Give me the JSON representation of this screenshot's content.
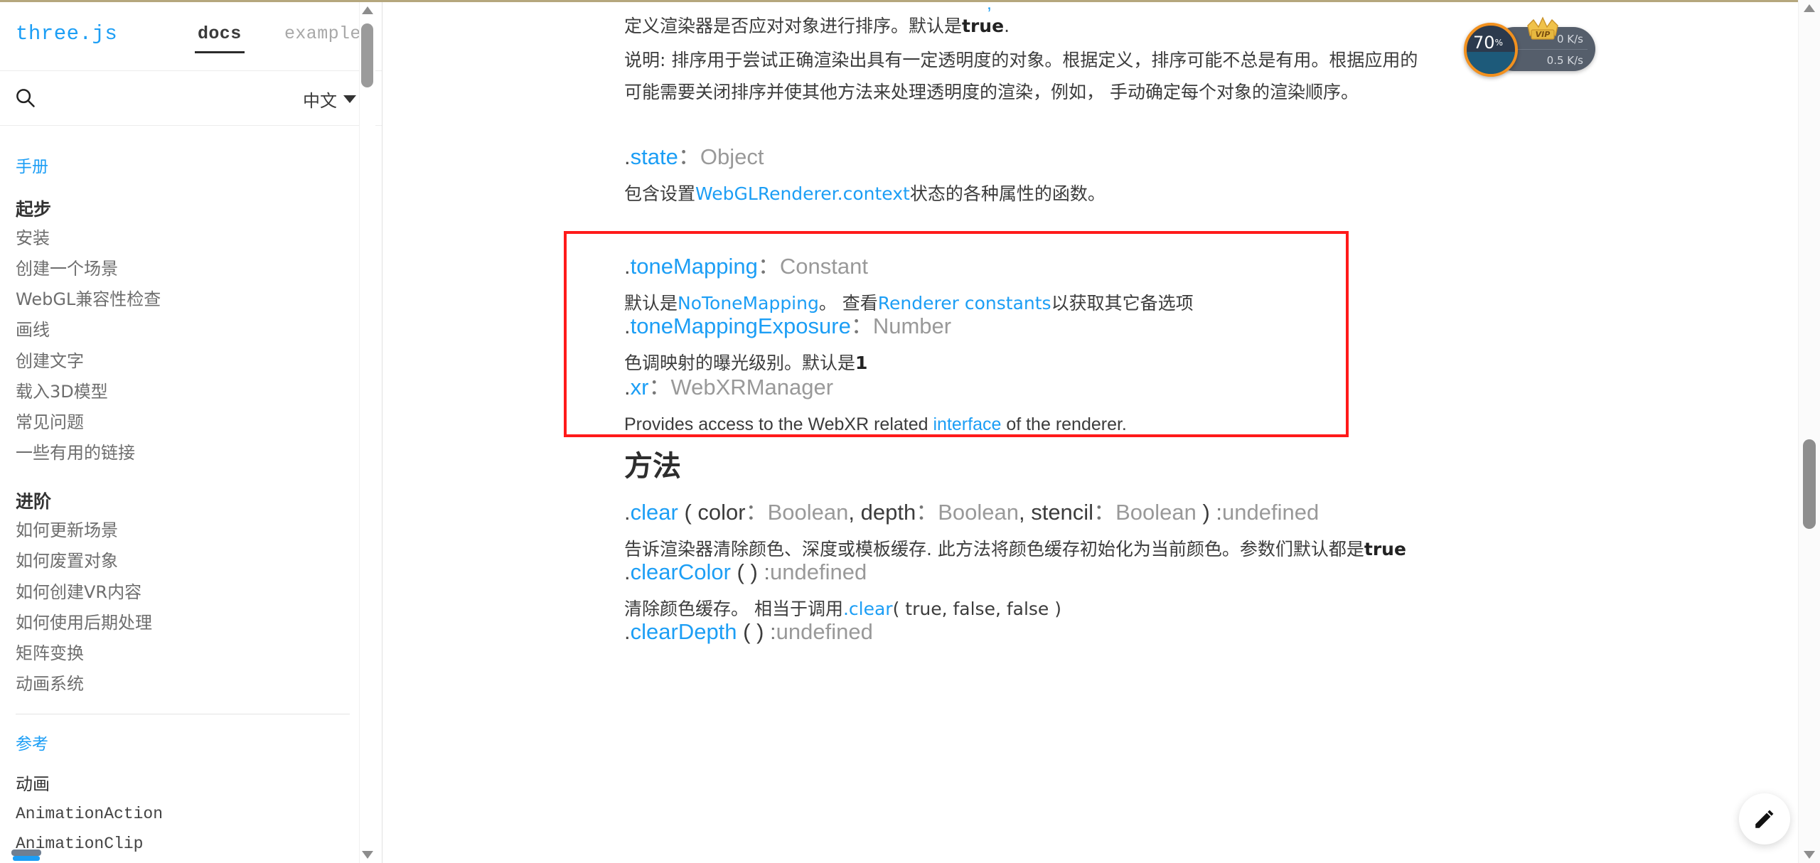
{
  "header": {
    "brand": "three.js",
    "tabs": [
      {
        "label": "docs",
        "active": true
      },
      {
        "label": "examples",
        "active": false
      }
    ],
    "search_icon": "search-icon",
    "language": {
      "label": "中文",
      "caret": "chevron-down-icon"
    }
  },
  "sidebar": {
    "sections": [
      {
        "heading": "手册",
        "groups": [
          {
            "title": "起步",
            "items": [
              "安装",
              "创建一个场景",
              "WebGL兼容性检查",
              "画线",
              "创建文字",
              "载入3D模型",
              "常见问题",
              "一些有用的链接"
            ]
          },
          {
            "title": "进阶",
            "items": [
              "如何更新场景",
              "如何废置对象",
              "如何创建VR内容",
              "如何使用后期处理",
              "矩阵变换",
              "动画系统"
            ]
          }
        ]
      },
      {
        "heading": "参考",
        "groups": [
          {
            "title": "动画",
            "items": [
              "AnimationAction",
              "AnimationClip"
            ]
          }
        ]
      }
    ]
  },
  "content": {
    "top_partial_text": "定义渲染器是否应对对象进行排序。默认是",
    "top_partial_bold": "true",
    "top_partial_suffix": ".",
    "note_line1_a": "说明: 排序用于尝试正确渲染出具有一定透明度的对象。根据定义，排序可能不总是有用。根据应用的",
    "note_line2_a": "可能需要关闭排序并使其他方法来处理透明度的渲染，例如，  手动确定每个对象的渲染顺序。",
    "entries": [
      {
        "name": ".state",
        "dot": ".",
        "bare": "state",
        "separator": "：",
        "type": "Object",
        "desc_parts": [
          {
            "text": "包含设置",
            "kind": "plain"
          },
          {
            "text": "WebGLRenderer.context",
            "kind": "link"
          },
          {
            "text": "状态的各种属性的函数。",
            "kind": "plain"
          }
        ]
      },
      {
        "name": ".toneMapping",
        "dot": ".",
        "bare": "toneMapping",
        "separator": "：",
        "type": "Constant",
        "highlighted": true,
        "desc_parts": [
          {
            "text": "默认是",
            "kind": "plain"
          },
          {
            "text": "NoToneMapping",
            "kind": "link"
          },
          {
            "text": "。 查看",
            "kind": "plain"
          },
          {
            "text": "Renderer constants",
            "kind": "link"
          },
          {
            "text": "以获取其它备选项",
            "kind": "plain"
          }
        ]
      },
      {
        "name": ".toneMappingExposure",
        "dot": ".",
        "bare": "toneMappingExposure",
        "separator": "：",
        "type": "Number",
        "highlighted": true,
        "desc_parts": [
          {
            "text": "色调映射的曝光级别。默认是",
            "kind": "plain"
          },
          {
            "text": "1",
            "kind": "bold"
          }
        ]
      },
      {
        "name": ".xr",
        "dot": ".",
        "bare": "xr",
        "separator": "：",
        "type": "WebXRManager",
        "desc_parts": [
          {
            "text": "Provides access to the WebXR related ",
            "kind": "plain"
          },
          {
            "text": "interface",
            "kind": "link"
          },
          {
            "text": " of the renderer.",
            "kind": "plain"
          }
        ]
      }
    ],
    "methods_heading": "方法",
    "methods": [
      {
        "dot": ".",
        "bare": "clear",
        "open": " ( ",
        "params": [
          {
            "name": "color",
            "sep": "：",
            "type": "Boolean"
          },
          {
            "name": "depth",
            "sep": "：",
            "type": "Boolean"
          },
          {
            "name": "stencil",
            "sep": "：",
            "type": "Boolean"
          }
        ],
        "close": " ) ",
        "ret_sep": "：",
        "ret": "undefined",
        "desc_parts": [
          {
            "text": "告诉渲染器清除颜色、深度或模板缓存. 此方法将颜色缓存初始化为当前颜色。参数们默认都是",
            "kind": "plain"
          },
          {
            "text": "true",
            "kind": "bold"
          }
        ]
      },
      {
        "dot": ".",
        "bare": "clearColor",
        "open": " ( ",
        "params": [],
        "close": " ) ",
        "ret_sep": "：",
        "ret": "undefined",
        "desc_parts": [
          {
            "text": "清除颜色缓存。 相当于调用",
            "kind": "plain"
          },
          {
            "text": ".clear",
            "kind": "link"
          },
          {
            "text": "( true, false, false )",
            "kind": "plain"
          }
        ]
      },
      {
        "dot": ".",
        "bare": "clearDepth",
        "open": " ( ",
        "params": [],
        "close": " ) ",
        "ret_sep": "：",
        "ret": "undefined",
        "desc_parts": []
      }
    ]
  },
  "download_widget": {
    "percent": "70",
    "percent_symbol": "%",
    "upload_speed": "0 K/s",
    "download_speed": "0.5 K/s",
    "badge_label": "VIP",
    "up_icon": "arrow-up-icon",
    "down_icon": "arrow-down-icon",
    "crown_icon": "crown-icon"
  },
  "fab": {
    "icon": "pencil-edit-icon"
  },
  "scrollbars": {
    "main": {
      "up": "scroll-up-arrow",
      "down": "scroll-down-arrow"
    },
    "sidebar": {
      "up": "scroll-up-arrow",
      "down": "scroll-down-arrow"
    }
  },
  "colors": {
    "brand_blue": "#1c9ef5",
    "link_blue": "#1c9ef5",
    "type_gray": "#999999",
    "highlight_red": "#ff1a1a",
    "text": "#3c3c3c"
  }
}
